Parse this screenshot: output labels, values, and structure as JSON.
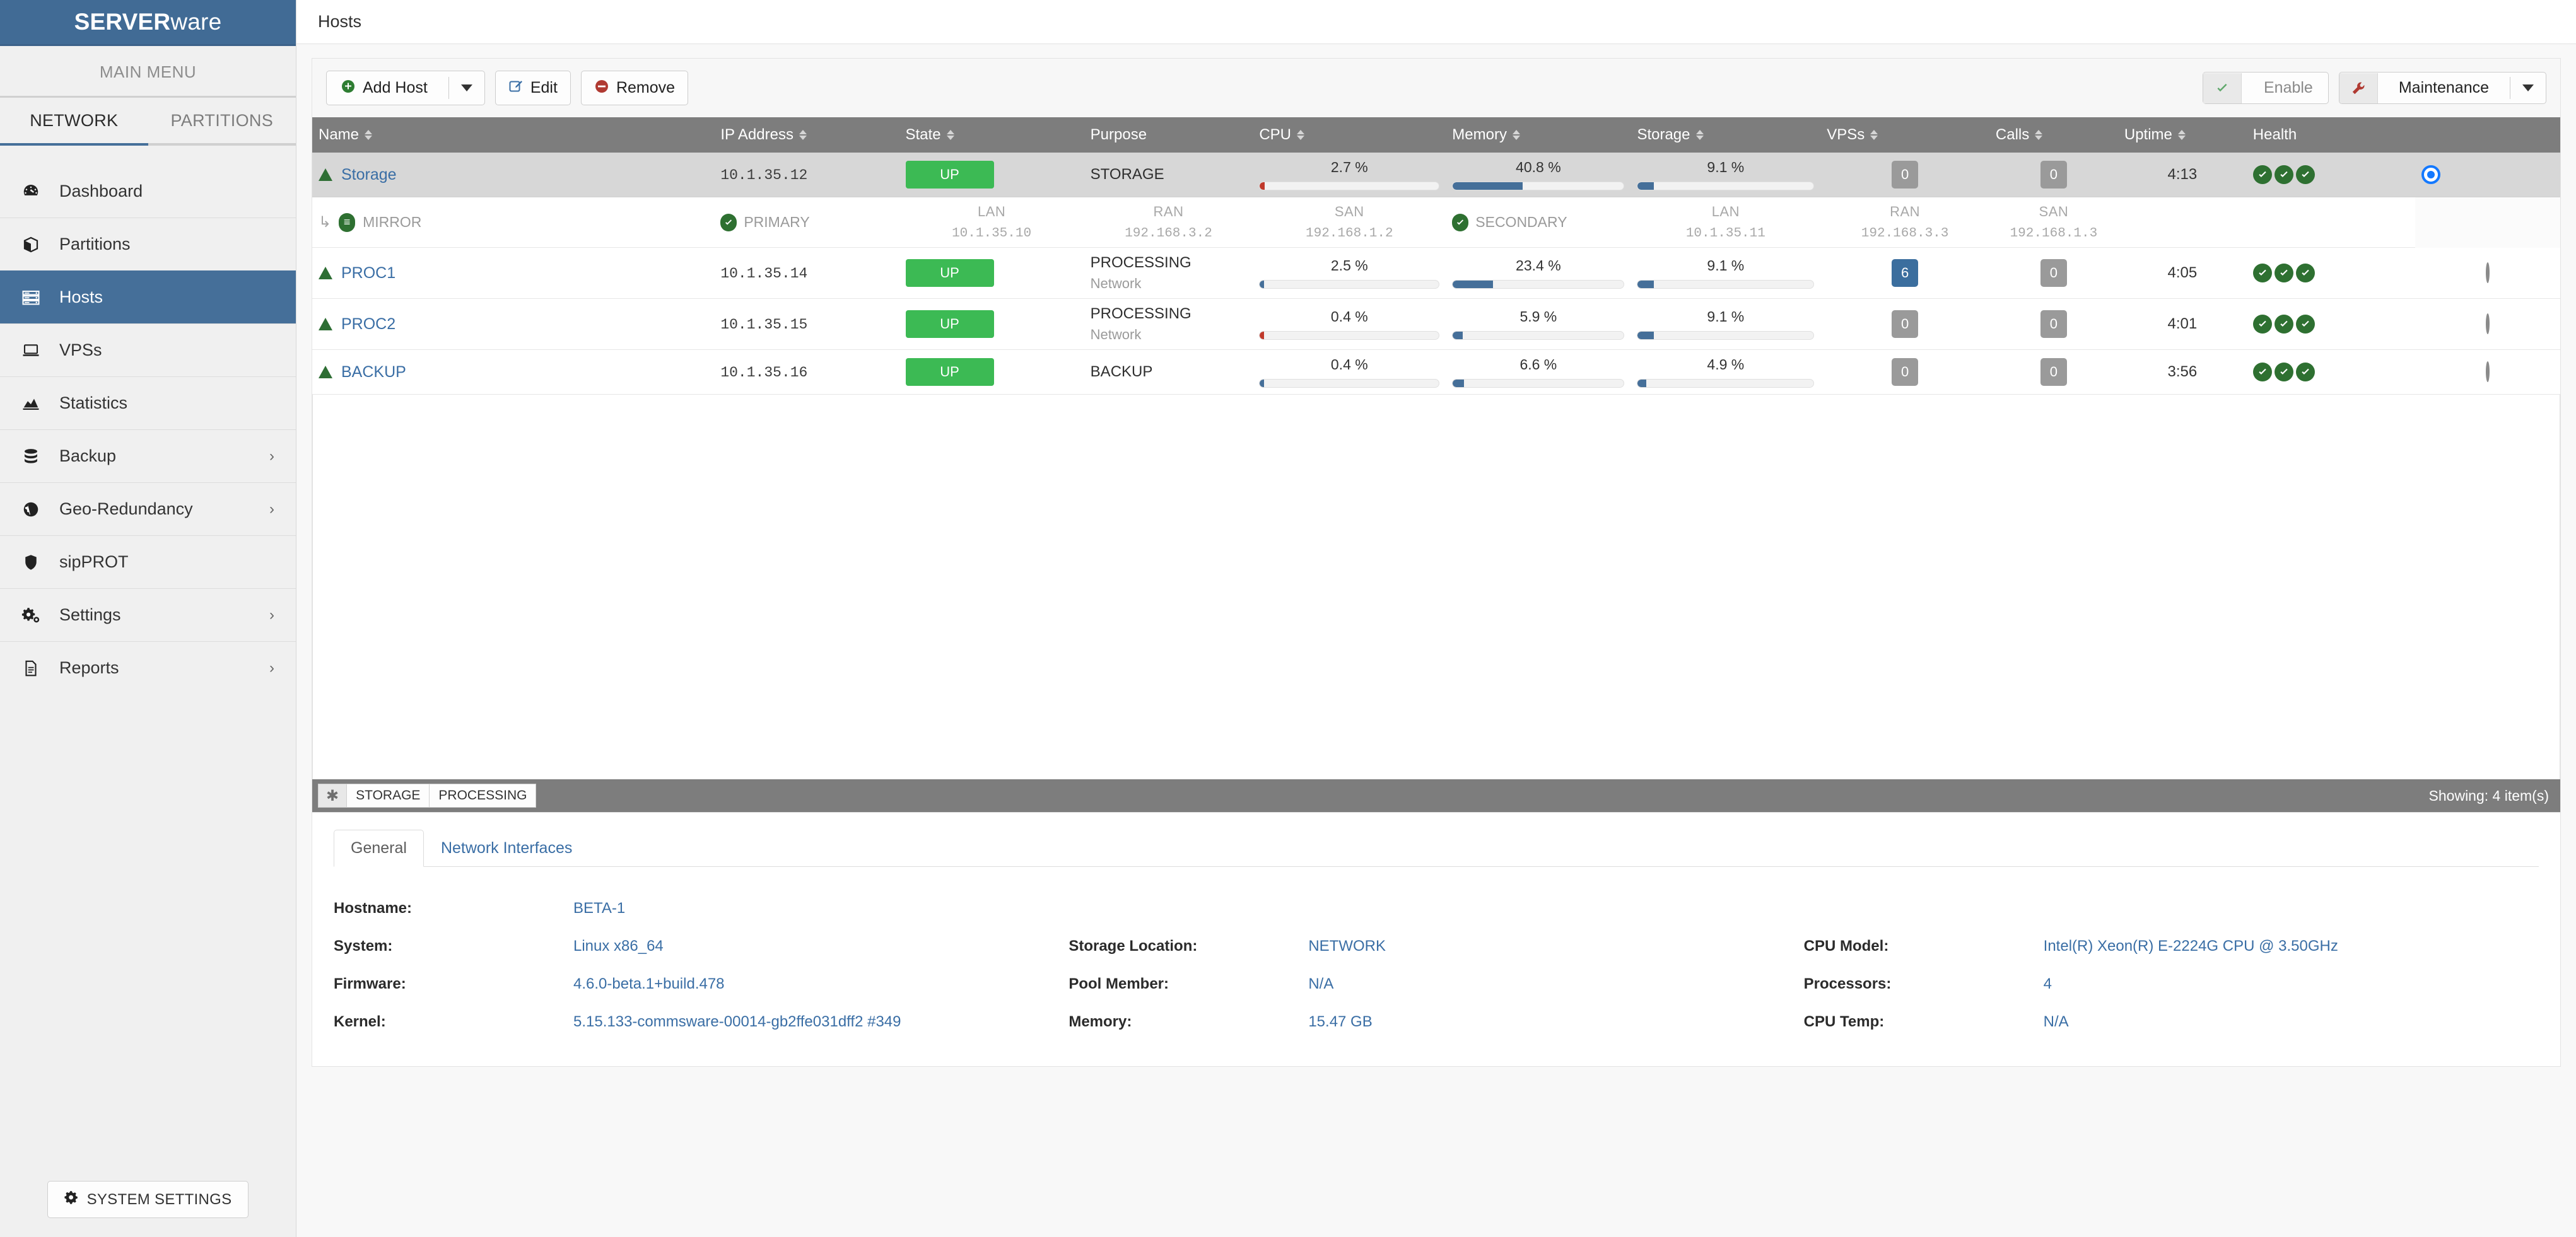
{
  "brand": {
    "bold": "SERVER",
    "light": "ware"
  },
  "sidebar": {
    "menu_title": "MAIN MENU",
    "tabs": [
      {
        "label": "NETWORK",
        "active": true
      },
      {
        "label": "PARTITIONS",
        "active": false
      }
    ],
    "items": [
      {
        "label": "Dashboard",
        "icon": "gauge-icon",
        "active": false,
        "chevron": false
      },
      {
        "label": "Partitions",
        "icon": "cube-icon",
        "active": false,
        "chevron": false
      },
      {
        "label": "Hosts",
        "icon": "server-icon",
        "active": true,
        "chevron": false
      },
      {
        "label": "VPSs",
        "icon": "laptop-icon",
        "active": false,
        "chevron": false
      },
      {
        "label": "Statistics",
        "icon": "chart-area-icon",
        "active": false,
        "chevron": false
      },
      {
        "label": "Backup",
        "icon": "database-icon",
        "active": false,
        "chevron": true
      },
      {
        "label": "Geo-Redundancy",
        "icon": "globe-icon",
        "active": false,
        "chevron": true
      },
      {
        "label": "sipPROT",
        "icon": "shield-icon",
        "active": false,
        "chevron": false
      },
      {
        "label": "Settings",
        "icon": "gears-icon",
        "active": false,
        "chevron": true
      },
      {
        "label": "Reports",
        "icon": "document-icon",
        "active": false,
        "chevron": true
      }
    ],
    "system_settings": "SYSTEM SETTINGS"
  },
  "topbar": {
    "title": "Hosts"
  },
  "toolbar": {
    "add_host": "Add Host",
    "edit": "Edit",
    "remove": "Remove",
    "enable": "Enable",
    "maintenance": "Maintenance"
  },
  "table": {
    "columns": [
      {
        "label": "Name",
        "sortable": true
      },
      {
        "label": "IP Address",
        "sortable": true
      },
      {
        "label": "State",
        "sortable": true
      },
      {
        "label": "Purpose",
        "sortable": false
      },
      {
        "label": "CPU",
        "sortable": true
      },
      {
        "label": "Memory",
        "sortable": true
      },
      {
        "label": "Storage",
        "sortable": true
      },
      {
        "label": "VPSs",
        "sortable": true
      },
      {
        "label": "Calls",
        "sortable": true
      },
      {
        "label": "Uptime",
        "sortable": true
      },
      {
        "label": "Health",
        "sortable": false
      },
      {
        "label": "",
        "sortable": false
      }
    ],
    "rows": [
      {
        "name": "Storage",
        "ip": "10.1.35.12",
        "state": "UP",
        "purpose": "STORAGE",
        "purpose_sub": "",
        "cpu": "2.7 %",
        "cpu_pct": 2.7,
        "cpu_red": true,
        "memory": "40.8 %",
        "memory_pct": 40.8,
        "storage": "9.1 %",
        "storage_pct": 9.1,
        "vpss": "0",
        "vpss_blue": false,
        "calls": "0",
        "calls_blue": false,
        "uptime": "4:13",
        "health": 3,
        "selected": true,
        "mirror": {
          "label": "MIRROR",
          "primary": {
            "role": "PRIMARY",
            "nets": [
              {
                "name": "LAN",
                "ip": "10.1.35.10"
              },
              {
                "name": "RAN",
                "ip": "192.168.3.2"
              },
              {
                "name": "SAN",
                "ip": "192.168.1.2"
              }
            ]
          },
          "secondary": {
            "role": "SECONDARY",
            "nets": [
              {
                "name": "LAN",
                "ip": "10.1.35.11"
              },
              {
                "name": "RAN",
                "ip": "192.168.3.3"
              },
              {
                "name": "SAN",
                "ip": "192.168.1.3"
              }
            ]
          }
        }
      },
      {
        "name": "PROC1",
        "ip": "10.1.35.14",
        "state": "UP",
        "purpose": "PROCESSING",
        "purpose_sub": "Network",
        "cpu": "2.5 %",
        "cpu_pct": 2.5,
        "cpu_red": false,
        "memory": "23.4 %",
        "memory_pct": 23.4,
        "storage": "9.1 %",
        "storage_pct": 9.1,
        "vpss": "6",
        "vpss_blue": true,
        "calls": "0",
        "calls_blue": false,
        "uptime": "4:05",
        "health": 3,
        "selected": false,
        "mirror": null
      },
      {
        "name": "PROC2",
        "ip": "10.1.35.15",
        "state": "UP",
        "purpose": "PROCESSING",
        "purpose_sub": "Network",
        "cpu": "0.4 %",
        "cpu_pct": 0.4,
        "cpu_red": true,
        "memory": "5.9 %",
        "memory_pct": 5.9,
        "storage": "9.1 %",
        "storage_pct": 9.1,
        "vpss": "0",
        "vpss_blue": false,
        "calls": "0",
        "calls_blue": false,
        "uptime": "4:01",
        "health": 3,
        "selected": false,
        "mirror": null
      },
      {
        "name": "BACKUP",
        "ip": "10.1.35.16",
        "state": "UP",
        "purpose": "BACKUP",
        "purpose_sub": "",
        "cpu": "0.4 %",
        "cpu_pct": 0.4,
        "cpu_red": false,
        "memory": "6.6 %",
        "memory_pct": 6.6,
        "storage": "4.9 %",
        "storage_pct": 4.9,
        "vpss": "0",
        "vpss_blue": false,
        "calls": "0",
        "calls_blue": false,
        "uptime": "3:56",
        "health": 3,
        "selected": false,
        "mirror": null
      }
    ]
  },
  "statusbar": {
    "chips": [
      "STORAGE",
      "PROCESSING"
    ],
    "showing": "Showing: 4 item(s)"
  },
  "detail": {
    "tabs": [
      {
        "label": "General",
        "active": true
      },
      {
        "label": "Network Interfaces",
        "active": false
      }
    ],
    "fields": {
      "hostname": {
        "label": "Hostname:",
        "value": "BETA-1"
      },
      "system": {
        "label": "System:",
        "value": "Linux x86_64"
      },
      "firmware": {
        "label": "Firmware:",
        "value": "4.6.0-beta.1+build.478"
      },
      "kernel": {
        "label": "Kernel:",
        "value": "5.15.133-commsware-00014-gb2ffe031dff2 #349"
      },
      "storage_location": {
        "label": "Storage Location:",
        "value": "NETWORK"
      },
      "pool_member": {
        "label": "Pool Member:",
        "value": "N/A"
      },
      "memory": {
        "label": "Memory:",
        "value": "15.47 GB"
      },
      "cpu_model": {
        "label": "CPU Model:",
        "value": "Intel(R) Xeon(R) E-2224G CPU @ 3.50GHz"
      },
      "processors": {
        "label": "Processors:",
        "value": "4"
      },
      "cpu_temp": {
        "label": "CPU Temp:",
        "value": "N/A"
      }
    }
  },
  "colors": {
    "brand": "#416b95",
    "accent": "#456f99",
    "state_up": "#3cba54",
    "health_ok": "#2e7031",
    "link": "#3a6ea5",
    "danger": "#b03a32"
  }
}
